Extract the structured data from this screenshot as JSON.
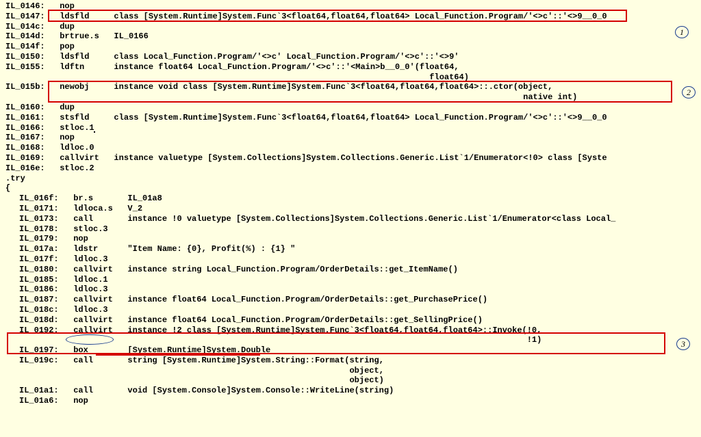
{
  "lines": [
    {
      "label": "IL_0146:",
      "op": "nop",
      "arg": ""
    },
    {
      "label": "IL_0147:",
      "op": "ldsfld",
      "arg": "class [System.Runtime]System.Func`3<float64,float64,float64> Local_Function.Program/'<>c'::'<>9__0_0"
    },
    {
      "label": "IL_014c:",
      "op": "dup",
      "arg": ""
    },
    {
      "label": "IL_014d:",
      "op": "brtrue.s",
      "arg": "IL_0166"
    },
    {
      "label": "IL_014f:",
      "op": "pop",
      "arg": ""
    },
    {
      "label": "IL_0150:",
      "op": "ldsfld",
      "arg": "class Local_Function.Program/'<>c' Local_Function.Program/'<>c'::'<>9'"
    },
    {
      "label": "IL_0155:",
      "op": "ldftn",
      "arg": "instance float64 Local_Function.Program/'<>c'::'<Main>b__0_0'(float64,"
    },
    {
      "label": "",
      "op": "",
      "arg": "                                                                float64)"
    },
    {
      "label": "IL_015b:",
      "op": "newobj",
      "arg": "instance void class [System.Runtime]System.Func`3<float64,float64,float64>::.ctor(object,"
    },
    {
      "label": "",
      "op": "",
      "arg": "                                                                                   native int)"
    },
    {
      "label": "IL_0160:",
      "op": "dup",
      "arg": ""
    },
    {
      "label": "IL_0161:",
      "op": "stsfld",
      "arg": "class [System.Runtime]System.Func`3<float64,float64,float64> Local_Function.Program/'<>c'::'<>9__0_0"
    },
    {
      "label": "IL_0166:",
      "op": "stloc.1",
      "arg": "",
      "cursor": true
    },
    {
      "label": "IL_0167:",
      "op": "nop",
      "arg": ""
    },
    {
      "label": "IL_0168:",
      "op": "ldloc.0",
      "arg": ""
    },
    {
      "label": "IL_0169:",
      "op": "callvirt",
      "arg": "instance valuetype [System.Collections]System.Collections.Generic.List`1/Enumerator<!0> class [Syste"
    },
    {
      "label": "IL_016e:",
      "op": "stloc.2",
      "arg": ""
    },
    {
      "label": ".try",
      "op": "",
      "arg": ""
    },
    {
      "label": "{",
      "op": "",
      "arg": ""
    }
  ],
  "inner": [
    {
      "label": "IL_016f:",
      "op": "br.s",
      "arg": "IL_01a8"
    },
    {
      "label": "IL_0171:",
      "op": "ldloca.s",
      "arg": "V_2"
    },
    {
      "label": "IL_0173:",
      "op": "call",
      "arg": "instance !0 valuetype [System.Collections]System.Collections.Generic.List`1/Enumerator<class Local_"
    },
    {
      "label": "IL_0178:",
      "op": "stloc.3",
      "arg": ""
    },
    {
      "label": "IL_0179:",
      "op": "nop",
      "arg": ""
    },
    {
      "label": "IL_017a:",
      "op": "ldstr",
      "arg": "\"Item Name: {0}, Profit(%) : {1} \""
    },
    {
      "label": "IL_017f:",
      "op": "ldloc.3",
      "arg": ""
    },
    {
      "label": "IL_0180:",
      "op": "callvirt",
      "arg": "instance string Local_Function.Program/OrderDetails::get_ItemName()"
    },
    {
      "label": "IL_0185:",
      "op": "ldloc.1",
      "arg": ""
    },
    {
      "label": "IL_0186:",
      "op": "ldloc.3",
      "arg": ""
    },
    {
      "label": "IL_0187:",
      "op": "callvirt",
      "arg": "instance float64 Local_Function.Program/OrderDetails::get_PurchasePrice()"
    },
    {
      "label": "IL_018c:",
      "op": "ldloc.3",
      "arg": ""
    },
    {
      "label": "IL_018d:",
      "op": "callvirt",
      "arg": "instance float64 Local_Function.Program/OrderDetails::get_SellingPrice()"
    },
    {
      "label": "IL_0192:",
      "op": "callvirt",
      "arg": "instance !2 class [System.Runtime]System.Func`3<float64,float64,float64>::Invoke(!0,"
    },
    {
      "label": "",
      "op": "",
      "arg": "                                                                                 !1)"
    },
    {
      "label": "IL_0197:",
      "op": "box",
      "arg": "[System.Runtime]System.Double"
    },
    {
      "label": "IL_019c:",
      "op": "call",
      "arg": "string [System.Runtime]System.String::Format(string,"
    },
    {
      "label": "",
      "op": "",
      "arg": "                                             object,"
    },
    {
      "label": "",
      "op": "",
      "arg": "                                             object)"
    },
    {
      "label": "IL_01a1:",
      "op": "call",
      "arg": "void [System.Console]System.Console::WriteLine(string)"
    },
    {
      "label": "IL_01a6:",
      "op": "nop",
      "arg": ""
    }
  ],
  "annotations": {
    "a1": "1",
    "a2": "2",
    "a3": "3"
  }
}
